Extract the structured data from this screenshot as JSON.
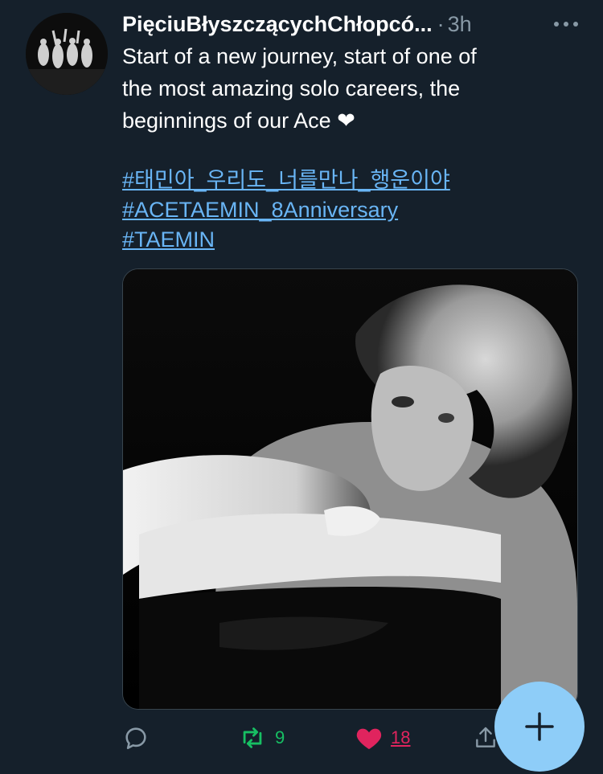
{
  "tweet": {
    "author": "PięciuBłyszczącychChłopcó...",
    "separator": "·",
    "time": "3h",
    "text_lines": [
      "Start of a new journey, start of one of",
      "the most amazing solo careers, the",
      "beginnings of our Ace ❤"
    ],
    "hashtags": [
      "#태민아_우리도_너를만나_행운이야",
      "#ACETAEMIN_8Anniversary",
      "#TAEMIN"
    ]
  },
  "actions": {
    "reply": {
      "icon": "reply-icon"
    },
    "retweet": {
      "icon": "retweet-icon",
      "count": "9",
      "color": "#17bf63"
    },
    "like": {
      "icon": "heart-icon",
      "count": "18",
      "color": "#e0245e"
    },
    "share": {
      "icon": "share-icon"
    }
  },
  "fab": {
    "icon": "plus-icon",
    "color": "#8ecdf8"
  },
  "colors": {
    "background": "#15202b",
    "secondary_text": "#8899a6",
    "link": "#69b5f5"
  }
}
